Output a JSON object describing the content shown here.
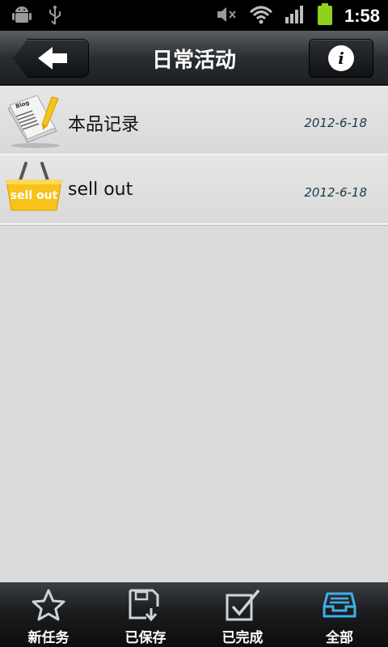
{
  "status": {
    "time": "1:58",
    "icons": [
      "android-debug-icon",
      "usb-icon",
      "mute-icon",
      "wifi-icon",
      "signal-icon",
      "battery-icon"
    ]
  },
  "header": {
    "title": "日常活动",
    "back_icon": "back-arrow-icon",
    "info_icon": "info-icon"
  },
  "list": {
    "items": [
      {
        "icon": "blog-note-icon",
        "label": "本品记录",
        "date": "2012-6-18"
      },
      {
        "icon": "shopping-basket-icon",
        "label": "sell out",
        "date": "2012-6-18",
        "icon_text": "sell out"
      }
    ]
  },
  "tabs": [
    {
      "label": "新任务",
      "icon": "star-icon"
    },
    {
      "label": "已保存",
      "icon": "save-icon"
    },
    {
      "label": "已完成",
      "icon": "checkbox-icon"
    },
    {
      "label": "全部",
      "icon": "inbox-icon",
      "active": true
    }
  ],
  "colors": {
    "accent_active": "#3fb0e8",
    "battery": "#8fd11c",
    "basket": "#f7c21a"
  }
}
